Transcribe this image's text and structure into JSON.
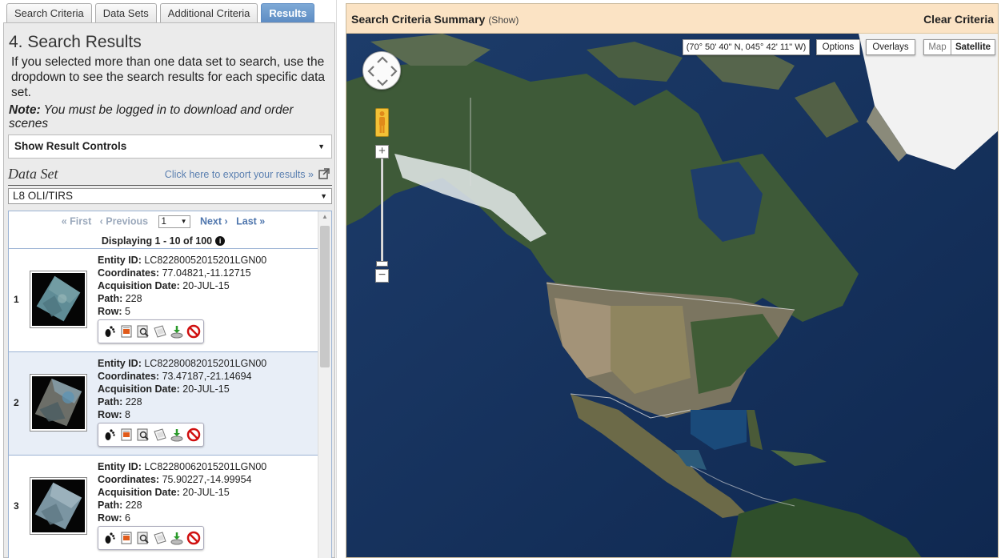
{
  "tabs": [
    {
      "label": "Search Criteria"
    },
    {
      "label": "Data Sets"
    },
    {
      "label": "Additional Criteria"
    },
    {
      "label": "Results"
    }
  ],
  "panel": {
    "heading": "4. Search Results",
    "intro": "If you selected more than one data set to search, use the dropdown to see the search results for each specific data set.",
    "note_label": "Note:",
    "note_text": " You must be logged in to download and order scenes",
    "result_controls": "Show Result Controls",
    "dataset_label": "Data Set",
    "export_link": "Click here to export your results »",
    "dataset_value": "L8 OLI/TIRS"
  },
  "pager": {
    "first": "« First",
    "previous": "‹ Previous",
    "page": "1",
    "next": "Next ›",
    "last": "Last »",
    "displaying": "Displaying 1 - 10 of 100"
  },
  "labels": {
    "entity": "Entity ID:",
    "coords": "Coordinates:",
    "acq": "Acquisition Date:",
    "path": "Path:",
    "row": "Row:"
  },
  "results": [
    {
      "num": "1",
      "entity_id": "LC82280052015201LGN00",
      "coordinates": "77.04821,-11.12715",
      "acquisition_date": "20-JUL-15",
      "path": "228",
      "row": "5"
    },
    {
      "num": "2",
      "entity_id": "LC82280082015201LGN00",
      "coordinates": "73.47187,-21.14694",
      "acquisition_date": "20-JUL-15",
      "path": "228",
      "row": "8"
    },
    {
      "num": "3",
      "entity_id": "LC82280062015201LGN00",
      "coordinates": "75.90227,-14.99954",
      "acquisition_date": "20-JUL-15",
      "path": "228",
      "row": "6"
    }
  ],
  "result_icons": [
    "footprint-icon",
    "metadata-icon",
    "browse-icon",
    "compare-icon",
    "download-icon",
    "exclude-icon"
  ],
  "map": {
    "criteria_title": "Search Criteria Summary",
    "criteria_show": "(Show)",
    "clear_criteria": "Clear Criteria",
    "coordinates": "(70° 50' 40\" N, 045° 42' 11\" W)",
    "options": "Options",
    "overlays": "Overlays",
    "map_type": "Map",
    "satellite_type": "Satellite",
    "zoom_in": "+",
    "zoom_out": "−"
  },
  "colors": {
    "active_tab": "#5d8cc3",
    "link": "#4f76ad",
    "criteria_bar": "#fbe3c4",
    "selected_row": "#e8eef7"
  }
}
